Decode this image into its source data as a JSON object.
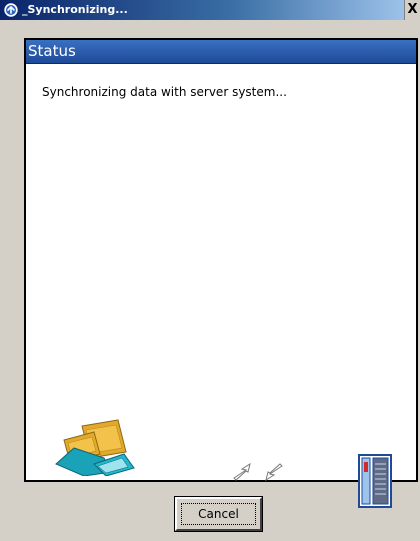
{
  "window": {
    "title": "_Synchronizing...",
    "close_glyph": "X",
    "title_icon": "sync-icon"
  },
  "panel": {
    "header": "Status",
    "message": "Synchronizing data with server system..."
  },
  "illustration": {
    "left_icon": "handheld-devices-icon",
    "middle_icon": "sync-arrows-icon",
    "right_icon": "server-tower-icon"
  },
  "buttons": {
    "cancel_label": "Cancel"
  },
  "colors": {
    "titlebar_start": "#0a246a",
    "titlebar_end": "#a6caf0",
    "panel_header": "#1e4a99",
    "dialog_background": "#d4d0c8",
    "devices_accent": "#e3a92c",
    "devices_teal": "#1aa3b8",
    "server_blue": "#1e4a99"
  }
}
